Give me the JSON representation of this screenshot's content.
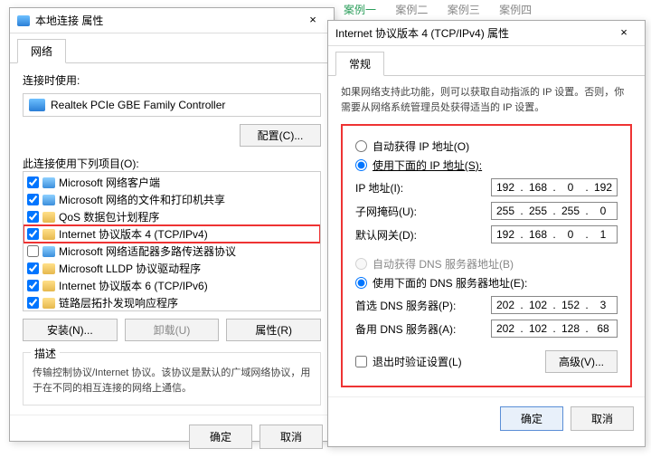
{
  "bg": {
    "t1": "案例一",
    "t2": "案例二",
    "t3": "案例三",
    "t4": "案例四"
  },
  "left": {
    "title": "本地连接 属性",
    "tab": "网络",
    "connect_using_label": "连接时使用:",
    "adapter": "Realtek PCIe GBE Family Controller",
    "configure": "配置(C)...",
    "items_label": "此连接使用下列项目(O):",
    "items": [
      {
        "checked": true,
        "icon": "net",
        "label": "Microsoft 网络客户端"
      },
      {
        "checked": true,
        "icon": "net",
        "label": "Microsoft 网络的文件和打印机共享"
      },
      {
        "checked": true,
        "icon": "proto",
        "label": "QoS 数据包计划程序"
      },
      {
        "checked": true,
        "icon": "proto",
        "label": "Internet 协议版本 4 (TCP/IPv4)",
        "highlight": true
      },
      {
        "checked": false,
        "icon": "net",
        "label": "Microsoft 网络适配器多路传送器协议"
      },
      {
        "checked": true,
        "icon": "proto",
        "label": "Microsoft LLDP 协议驱动程序"
      },
      {
        "checked": true,
        "icon": "proto",
        "label": "Internet 协议版本 6 (TCP/IPv6)"
      },
      {
        "checked": true,
        "icon": "proto",
        "label": "链路层拓扑发现响应程序"
      }
    ],
    "install": "安装(N)...",
    "uninstall": "卸载(U)",
    "props": "属性(R)",
    "desc_label": "描述",
    "desc": "传输控制协议/Internet 协议。该协议是默认的广域网络协议，用于在不同的相互连接的网络上通信。",
    "ok": "确定",
    "cancel": "取消"
  },
  "right": {
    "title": "Internet 协议版本 4 (TCP/IPv4) 属性",
    "tab": "常规",
    "intro": "如果网络支持此功能，则可以获取自动指派的 IP 设置。否则，你需要从网络系统管理员处获得适当的 IP 设置。",
    "auto_ip": "自动获得 IP 地址(O)",
    "manual_ip": "使用下面的 IP 地址(S):",
    "ip_label": "IP 地址(I):",
    "mask_label": "子网掩码(U):",
    "gw_label": "默认网关(D):",
    "ip": [
      "192",
      "168",
      "0",
      "192"
    ],
    "mask": [
      "255",
      "255",
      "255",
      "0"
    ],
    "gw": [
      "192",
      "168",
      "0",
      "1"
    ],
    "auto_dns": "自动获得 DNS 服务器地址(B)",
    "manual_dns": "使用下面的 DNS 服务器地址(E):",
    "dns1_label": "首选 DNS 服务器(P):",
    "dns2_label": "备用 DNS 服务器(A):",
    "dns1": [
      "202",
      "102",
      "152",
      "3"
    ],
    "dns2": [
      "202",
      "102",
      "128",
      "68"
    ],
    "validate": "退出时验证设置(L)",
    "advanced": "高级(V)...",
    "ok": "确定",
    "cancel": "取消"
  }
}
